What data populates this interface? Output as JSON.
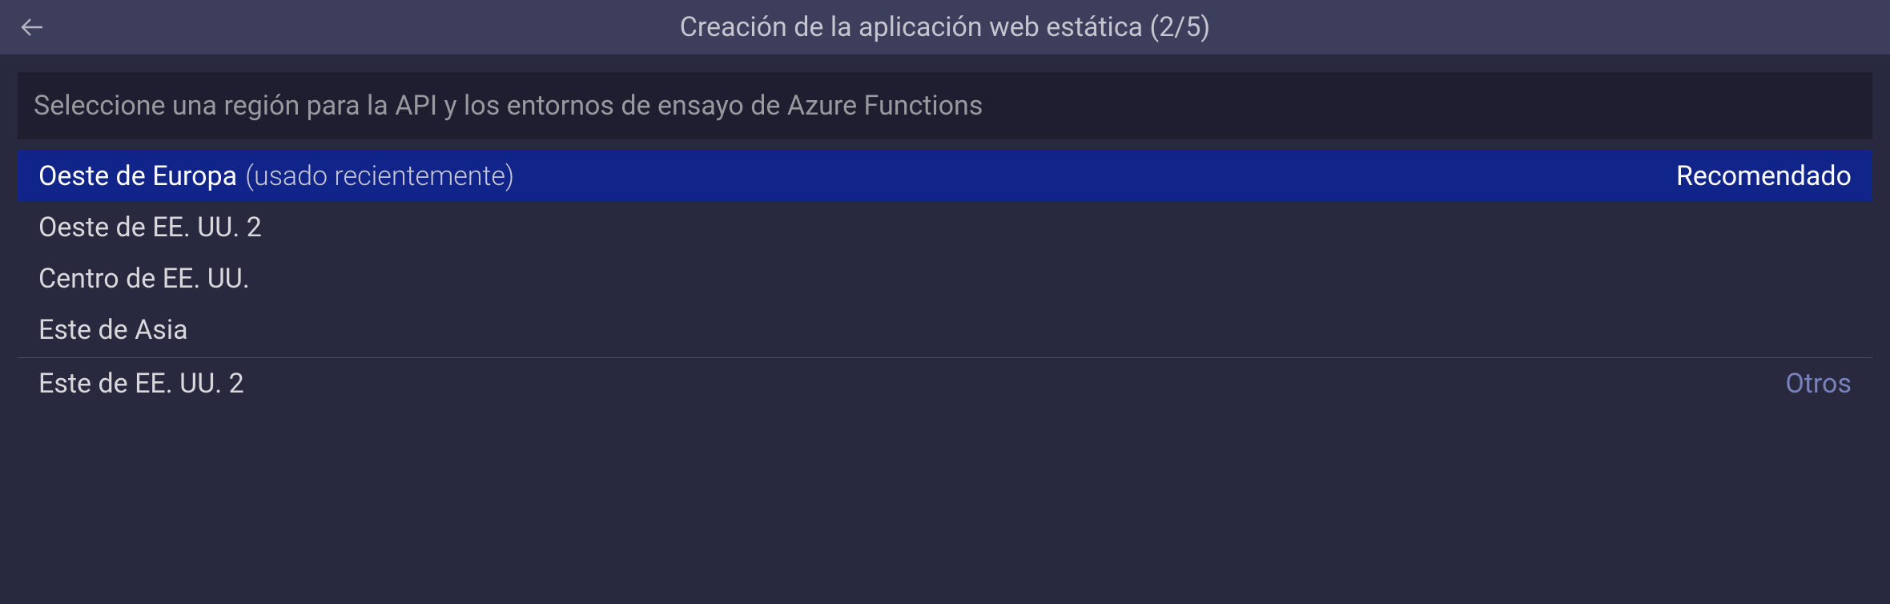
{
  "header": {
    "title": "Creación de la aplicación web estática (2/5)"
  },
  "search": {
    "placeholder": "Seleccione una región para la API y los entornos de ensayo de Azure Functions"
  },
  "list": {
    "items": [
      {
        "label": "Oeste de Europa",
        "hint": "(usado recientemente)",
        "right": "Recomendado",
        "selected": true
      },
      {
        "label": "Oeste de EE. UU. 2"
      },
      {
        "label": "Centro de EE. UU."
      },
      {
        "label": "Este de Asia"
      }
    ],
    "secondary_items": [
      {
        "label": "Este de EE. UU. 2",
        "right": "Otros",
        "right_link": true
      }
    ]
  }
}
